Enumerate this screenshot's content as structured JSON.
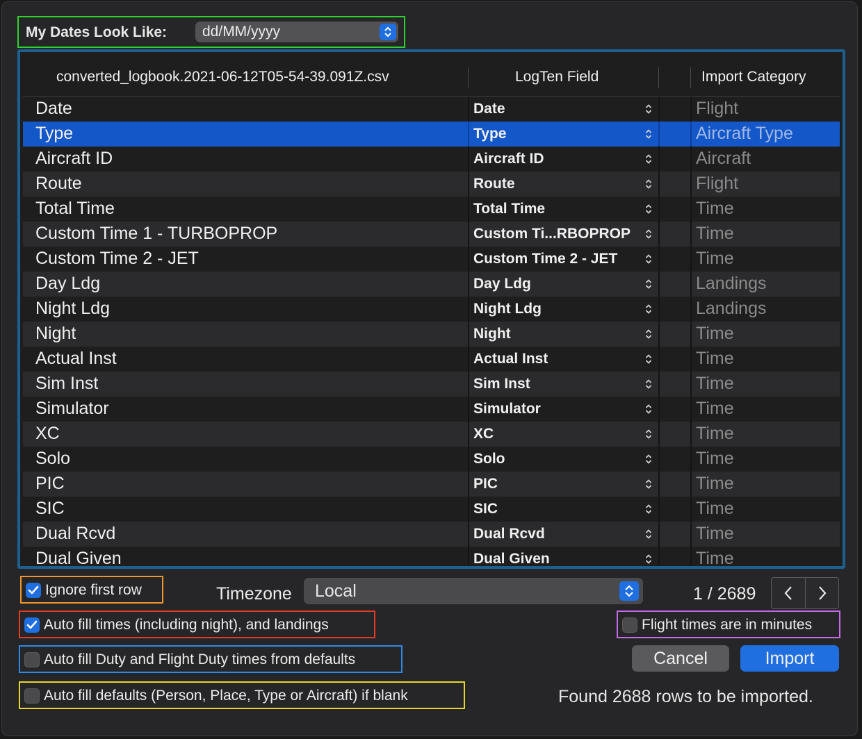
{
  "date_format": {
    "label": "My Dates Look Like:",
    "value": "dd/MM/yyyy"
  },
  "table": {
    "headers": {
      "file": "converted_logbook.2021-06-12T05-54-39.091Z.csv",
      "logten_field": "LogTen Field",
      "import_category": "Import Category"
    },
    "selected_index": 1,
    "rows": [
      {
        "file": "Date",
        "field": "Date",
        "category": "Flight"
      },
      {
        "file": "Type",
        "field": "Type",
        "category": "Aircraft Type"
      },
      {
        "file": "Aircraft ID",
        "field": "Aircraft ID",
        "category": "Aircraft"
      },
      {
        "file": "Route",
        "field": "Route",
        "category": "Flight"
      },
      {
        "file": "Total Time",
        "field": "Total Time",
        "category": "Time"
      },
      {
        "file": "Custom Time 1 - TURBOPROP",
        "field": "Custom Ti...RBOPROP",
        "category": "Time"
      },
      {
        "file": "Custom Time 2 - JET",
        "field": "Custom Time 2 - JET",
        "category": "Time"
      },
      {
        "file": "Day Ldg",
        "field": "Day Ldg",
        "category": "Landings"
      },
      {
        "file": "Night Ldg",
        "field": "Night Ldg",
        "category": "Landings"
      },
      {
        "file": "Night",
        "field": "Night",
        "category": "Time"
      },
      {
        "file": "Actual Inst",
        "field": "Actual Inst",
        "category": "Time"
      },
      {
        "file": "Sim Inst",
        "field": "Sim Inst",
        "category": "Time"
      },
      {
        "file": "Simulator",
        "field": "Simulator",
        "category": "Time"
      },
      {
        "file": "XC",
        "field": "XC",
        "category": "Time"
      },
      {
        "file": "Solo",
        "field": "Solo",
        "category": "Time"
      },
      {
        "file": "PIC",
        "field": "PIC",
        "category": "Time"
      },
      {
        "file": "SIC",
        "field": "SIC",
        "category": "Time"
      },
      {
        "file": "Dual Rcvd",
        "field": "Dual Rcvd",
        "category": "Time"
      },
      {
        "file": "Dual Given",
        "field": "Dual Given",
        "category": "Time"
      }
    ]
  },
  "options": {
    "ignore_first_row": {
      "label": "Ignore first row",
      "checked": true
    },
    "auto_fill_times": {
      "label": "Auto fill times (including night), and landings",
      "checked": true
    },
    "auto_fill_duty": {
      "label": "Auto fill Duty and Flight Duty times from defaults",
      "checked": false
    },
    "auto_fill_defaults": {
      "label": "Auto fill defaults (Person, Place, Type or Aircraft) if blank",
      "checked": false
    },
    "flight_times_minutes": {
      "label": "Flight times are in minutes",
      "checked": false
    }
  },
  "timezone": {
    "label": "Timezone",
    "value": "Local"
  },
  "pager": {
    "counter": "1 / 2689"
  },
  "buttons": {
    "cancel": "Cancel",
    "import": "Import"
  },
  "status": {
    "found": "Found 2688 rows to be imported."
  },
  "colors": {
    "accent": "#1f6fe0",
    "selected_row": "#1457c8",
    "table_frame": "#1d5f8f"
  }
}
